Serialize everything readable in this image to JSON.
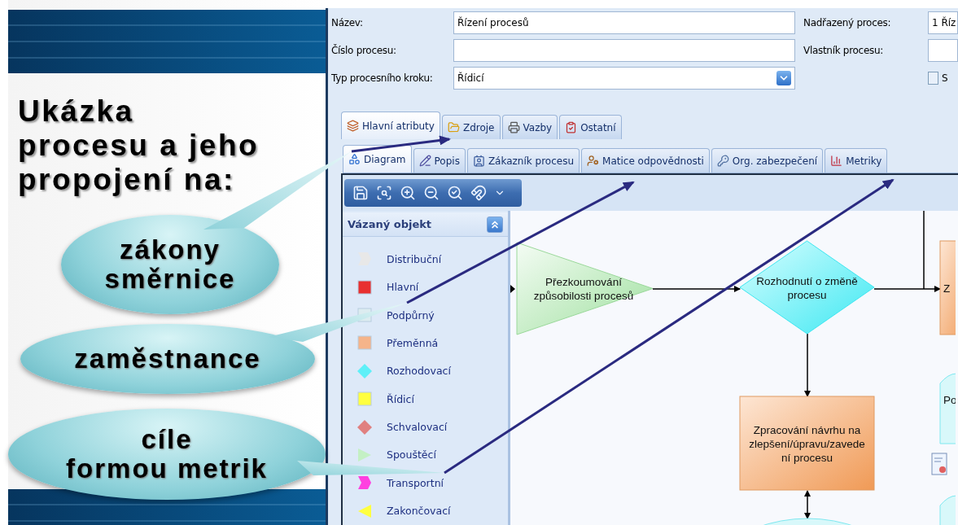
{
  "slide": {
    "title": [
      "Ukázka",
      "procesu a jeho",
      "propojení na:"
    ],
    "callouts": [
      {
        "lines": [
          "zákony",
          "směrnice"
        ]
      },
      {
        "lines": [
          "zaměstnance"
        ]
      },
      {
        "lines": [
          "cíle",
          "formou metrik"
        ]
      }
    ]
  },
  "form": {
    "left": [
      {
        "kind": "text",
        "label": "Název:",
        "value": "Řízení procesů"
      },
      {
        "kind": "text",
        "label": "Číslo procesu:"
      },
      {
        "kind": "select",
        "label": "Typ procesního kroku:",
        "value": "Řídicí"
      }
    ],
    "right": [
      {
        "kind": "text",
        "label": "Nadřazený proces:",
        "value": "1 Říz"
      },
      {
        "kind": "text",
        "label": "Vlastník procesu:"
      },
      {
        "kind": "checkbox",
        "label": "S",
        "checked": false
      }
    ]
  },
  "tabs": [
    {
      "label": "Hlavní atributy",
      "selected": true
    },
    {
      "label": "Zdroje",
      "selected": false
    },
    {
      "label": "Vazby",
      "selected": false
    },
    {
      "label": "Ostatní",
      "selected": false
    }
  ],
  "subtabs": [
    {
      "label": "Diagram",
      "selected": true
    },
    {
      "label": "Popis",
      "selected": false
    },
    {
      "label": "Zákazník procesu",
      "selected": false
    },
    {
      "label": "Matice odpovědnosti",
      "selected": false
    },
    {
      "label": "Org. zabezpečení",
      "selected": false
    },
    {
      "label": "Metriky",
      "selected": false
    }
  ],
  "panel": {
    "title": "Vázaný objekt",
    "items": [
      {
        "label": "Distribuční",
        "kind": "notch",
        "color": "#e8e8e8"
      },
      {
        "label": "Hlavní",
        "kind": "square",
        "color": "#e83030"
      },
      {
        "label": "Podpůrný",
        "kind": "square",
        "color": "#dcecf0"
      },
      {
        "label": "Přeměnná",
        "kind": "square",
        "color": "#f5b48a"
      },
      {
        "label": "Rozhodovací",
        "kind": "diamond",
        "color": "#5ef0f8"
      },
      {
        "label": "Řídicí",
        "kind": "square",
        "color": "#ffff40"
      },
      {
        "label": "Schvalovací",
        "kind": "diamond",
        "color": "#e08080"
      },
      {
        "label": "Spouštěcí",
        "kind": "triangle-right",
        "color": "#c4f0c4"
      },
      {
        "label": "Transportní",
        "kind": "notch",
        "color": "#ff40e0"
      },
      {
        "label": "Zakončovací",
        "kind": "triangle-left",
        "color": "#ffff40"
      }
    ]
  },
  "diagram": {
    "nodes": [
      {
        "kind": "trigger",
        "lines": [
          "Přezkoumování",
          "způsobilosti procesů"
        ]
      },
      {
        "kind": "decision",
        "lines": [
          "Rozhodnutí o změně",
          "procesu"
        ]
      },
      {
        "kind": "process",
        "lines": [
          "Z"
        ]
      },
      {
        "kind": "process",
        "lines": [
          "Zpracování návrhu na",
          "zlepšení/úpravu/zavede",
          "ní procesu"
        ]
      },
      {
        "kind": "store",
        "lines": [
          "Po"
        ]
      },
      {
        "kind": "store"
      },
      {
        "kind": "store"
      }
    ]
  }
}
